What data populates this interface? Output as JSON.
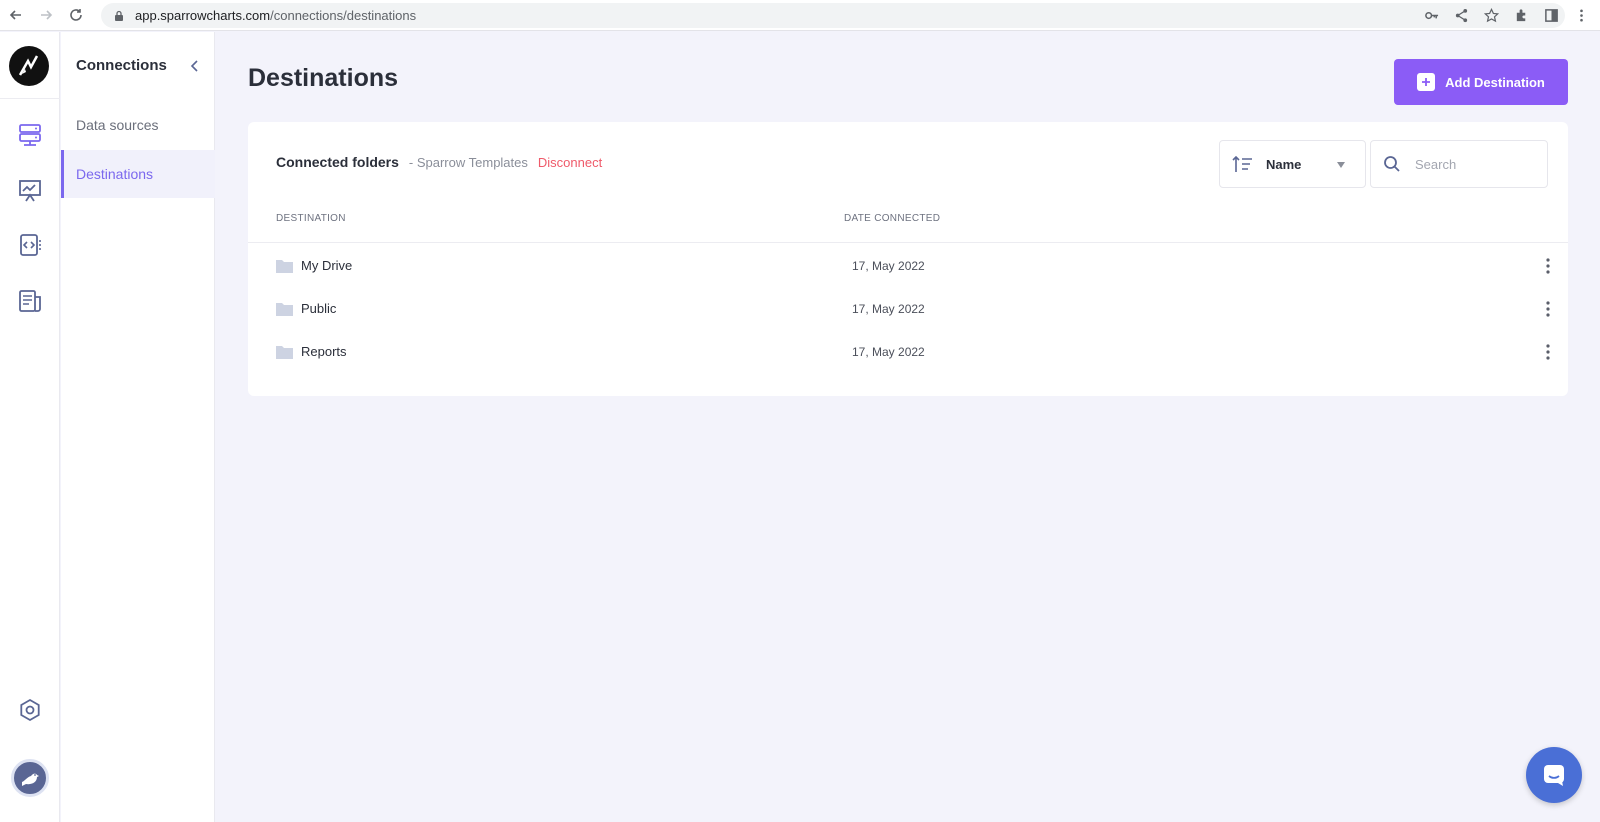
{
  "browser": {
    "url_host": "app.sparrowcharts.com",
    "url_path": "/connections/destinations"
  },
  "subnav": {
    "title": "Connections",
    "items": [
      {
        "label": "Data sources",
        "active": false
      },
      {
        "label": "Destinations",
        "active": true
      }
    ]
  },
  "page": {
    "title": "Destinations",
    "add_button_label": "Add Destination"
  },
  "card": {
    "title": "Connected folders",
    "folder_source": "- Sparrow Templates",
    "disconnect_label": "Disconnect",
    "sort": {
      "label": "Name"
    },
    "search": {
      "placeholder": "Search"
    },
    "columns": [
      "DESTINATION",
      "DATE CONNECTED"
    ],
    "rows": [
      {
        "name": "My Drive",
        "date": "17, May 2022"
      },
      {
        "name": "Public",
        "date": "17, May 2022"
      },
      {
        "name": "Reports",
        "date": "17, May 2022"
      }
    ]
  },
  "colors": {
    "accent": "#8b5cf6",
    "active_nav": "#7b68ee",
    "danger": "#ef5a6a",
    "chat": "#4a6fd6"
  },
  "icons": {
    "rail": [
      "database-icon",
      "presentation-chart-icon",
      "code-file-icon",
      "report-icon",
      "settings-icon"
    ],
    "row_actions": "more-vertical-icon"
  }
}
